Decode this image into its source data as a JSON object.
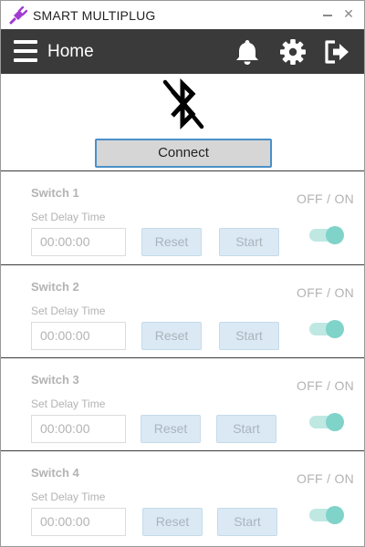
{
  "window": {
    "title": "SMART MULTIPLUG",
    "minimize_icon": "minimize-icon",
    "close_icon": "close-icon",
    "close_glyph": "✕"
  },
  "header": {
    "title": "Home",
    "background": "#3a3a3a",
    "icons": [
      "menu-icon",
      "bell-icon",
      "gear-icon",
      "logout-icon"
    ]
  },
  "bluetooth": {
    "icon": "bluetooth-disabled-icon",
    "connect_label": "Connect"
  },
  "switches": [
    {
      "name": "Switch 1",
      "delay_label": "Set Delay Time",
      "time": "00:00:00",
      "reset_label": "Reset",
      "start_label": "Start",
      "state_label": "OFF / ON"
    },
    {
      "name": "Switch 2",
      "delay_label": "Set Delay Time",
      "time": "00:00:00",
      "reset_label": "Reset",
      "start_label": "Start",
      "state_label": "OFF / ON"
    },
    {
      "name": "Switch 3",
      "delay_label": "Set Delay Time",
      "time": "00:00:00",
      "reset_label": "Reset",
      "start_label": "Start",
      "state_label": "OFF / ON"
    },
    {
      "name": "Switch 4",
      "delay_label": "Set Delay Time",
      "time": "00:00:00",
      "reset_label": "Reset",
      "start_label": "Start",
      "state_label": "OFF / ON"
    }
  ],
  "colors": {
    "accent": "#7fd3c8",
    "connect_border": "#4a90c8",
    "disabled_text": "#b3b3b3",
    "button_fill": "#dbe9f4",
    "app_icon": "#a23bd1"
  }
}
